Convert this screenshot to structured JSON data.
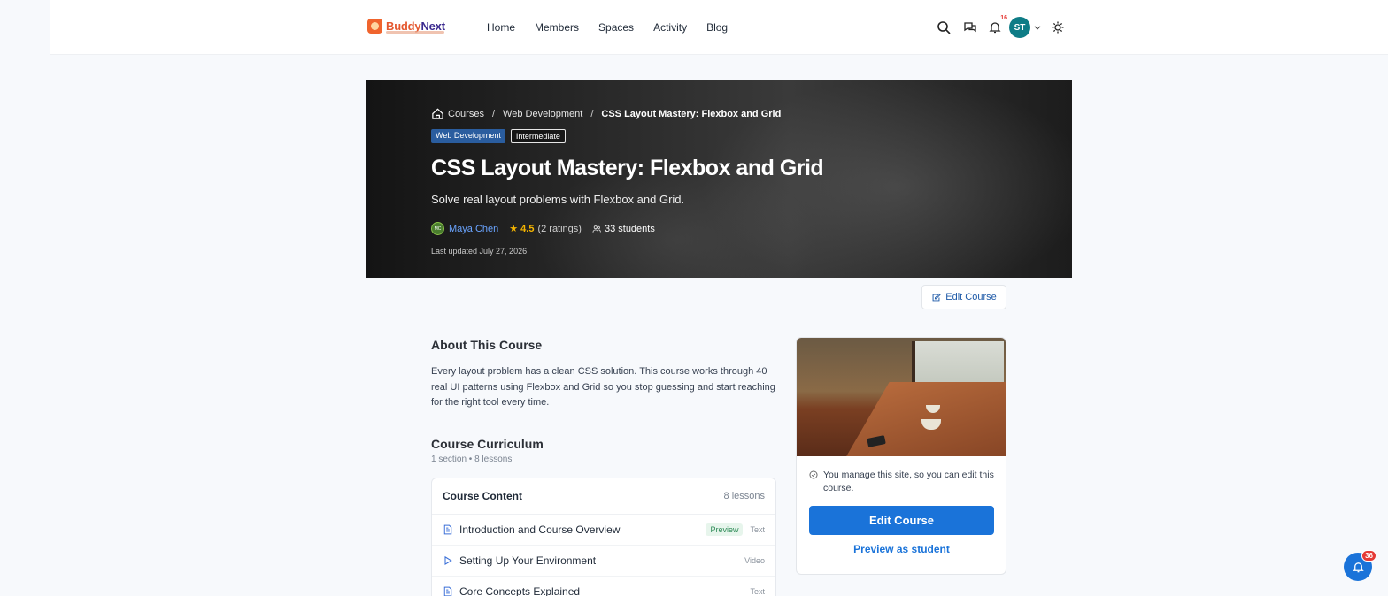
{
  "header": {
    "brand": {
      "name_part1": "Buddy",
      "name_part2": "Next"
    },
    "nav": [
      "Home",
      "Members",
      "Spaces",
      "Activity",
      "Blog"
    ],
    "notification_count": "16",
    "avatar_initials": "ST"
  },
  "hero": {
    "breadcrumbs": {
      "root": "Courses",
      "category": "Web Development",
      "current": "CSS Layout Mastery: Flexbox and Grid"
    },
    "tags": {
      "category": "Web Development",
      "level": "Intermediate"
    },
    "title": "CSS Layout Mastery: Flexbox and Grid",
    "subtitle": "Solve real layout problems with Flexbox and Grid.",
    "instructor": {
      "initials": "MC",
      "name": "Maya Chen"
    },
    "rating": "4.5",
    "ratings_count": "(2 ratings)",
    "students": "33 students",
    "updated": "Last updated July 27, 2026"
  },
  "edit_course_top": "Edit Course",
  "about": {
    "heading": "About This Course",
    "text": "Every layout problem has a clean CSS solution. This course works through 40 real UI patterns using Flexbox and Grid so you stop guessing and start reaching for the right tool every time."
  },
  "curriculum": {
    "heading": "Course Curriculum",
    "summary": "1 section • 8 lessons",
    "box_title": "Course Content",
    "box_count": "8 lessons",
    "lessons": [
      {
        "title": "Introduction and Course Overview",
        "preview": "Preview",
        "type": "Text",
        "icon": "document-icon"
      },
      {
        "title": "Setting Up Your Environment",
        "preview": "",
        "type": "Video",
        "icon": "play-icon"
      },
      {
        "title": "Core Concepts Explained",
        "preview": "",
        "type": "Text",
        "icon": "document-icon"
      }
    ]
  },
  "sidecard": {
    "note": "You manage this site, so you can edit this course.",
    "edit_button": "Edit Course",
    "preview_link": "Preview as student"
  },
  "floating_badge": "36",
  "colors": {
    "primary": "#1a73d9",
    "brand": "#e4572e",
    "avatar": "#0e7c86"
  }
}
